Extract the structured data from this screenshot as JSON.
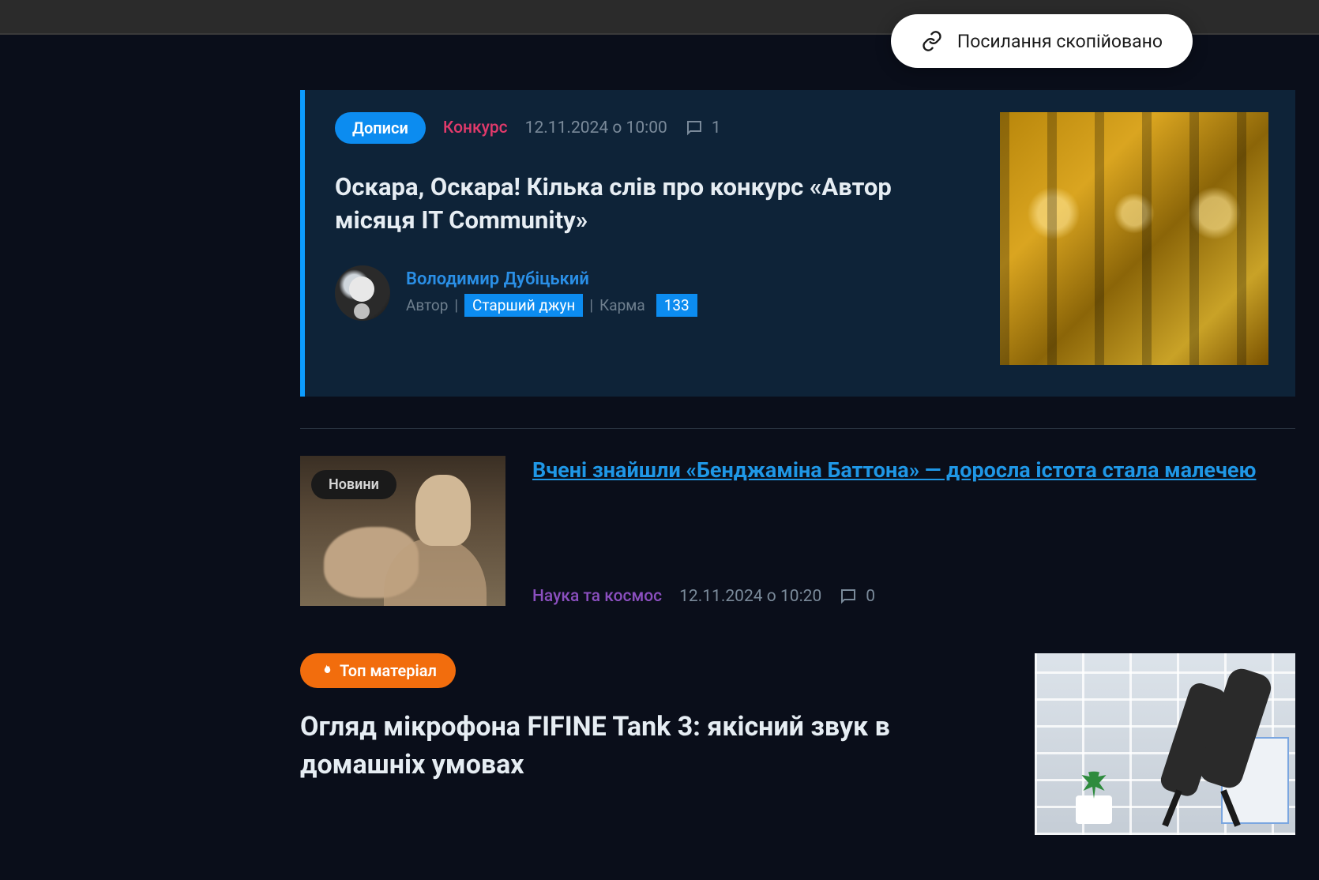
{
  "toast": {
    "text": "Посилання скопійовано"
  },
  "article1": {
    "badge": "Дописи",
    "tag": "Конкурс",
    "date": "12.11.2024 о 10:00",
    "comments": "1",
    "title": "Оскара, Оскара! Кілька слів про конкурс «Автор місяця IT Community»",
    "author": {
      "name": "Володимир Дубіцький",
      "role_label": "Автор",
      "rank": "Старший джун",
      "karma_label": "Карма",
      "karma": "133"
    }
  },
  "article2": {
    "badge": "Новини",
    "title": "Вчені знайшли «Бенджаміна Баттона» — доросла істота стала малечею",
    "tag": "Наука та космос",
    "date": "12.11.2024 о 10:20",
    "comments": "0"
  },
  "article3": {
    "badge": "Топ матеріал",
    "title": "Огляд мікрофона FIFINE Tank 3: якісний звук в домашніх умовах"
  }
}
